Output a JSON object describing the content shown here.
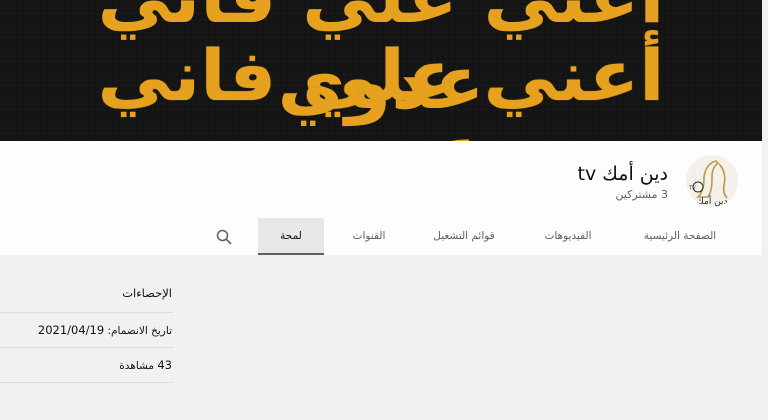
{
  "banner": {
    "text": "أعني علي فاني عدوي"
  },
  "channel": {
    "title": "دين أمك tv",
    "subscribers": "3 مشتركين",
    "avatar_text": "دين أمك"
  },
  "tabs": [
    {
      "label": "الصفحة الرئيسية"
    },
    {
      "label": "الفيديوهات"
    },
    {
      "label": "قوائم التشغيل"
    },
    {
      "label": "القنوات"
    },
    {
      "label": "لمحة"
    }
  ],
  "about": {
    "stats_heading": "الإحصاءات",
    "joined_label": "تاريخ الانضمام:",
    "joined_date": "2021/04/19",
    "views_count": "43",
    "views_label": "مشاهدة"
  },
  "colors": {
    "banner_bg": "#141414",
    "banner_text": "#e6a21e",
    "active_tab_bg": "#e7e7e7"
  },
  "icons": {
    "search": "search-icon"
  }
}
